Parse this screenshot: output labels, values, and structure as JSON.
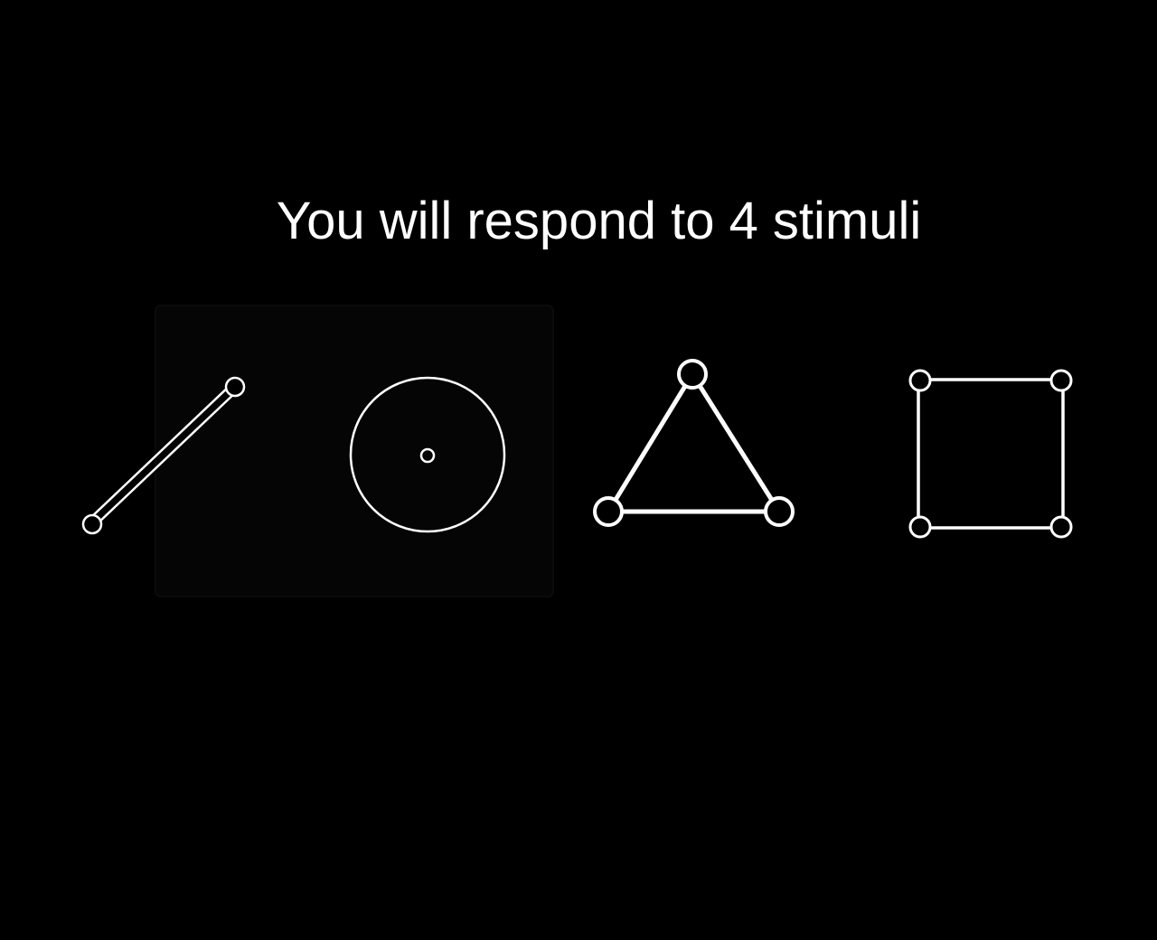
{
  "instruction": "You will respond to 4 stimuli",
  "colors": {
    "background": "#000000",
    "foreground": "#ffffff"
  },
  "stimuli": [
    {
      "name": "line",
      "icon": "line-stimulus-icon"
    },
    {
      "name": "circle",
      "icon": "circle-stimulus-icon"
    },
    {
      "name": "triangle",
      "icon": "triangle-stimulus-icon"
    },
    {
      "name": "square",
      "icon": "square-stimulus-icon"
    }
  ]
}
